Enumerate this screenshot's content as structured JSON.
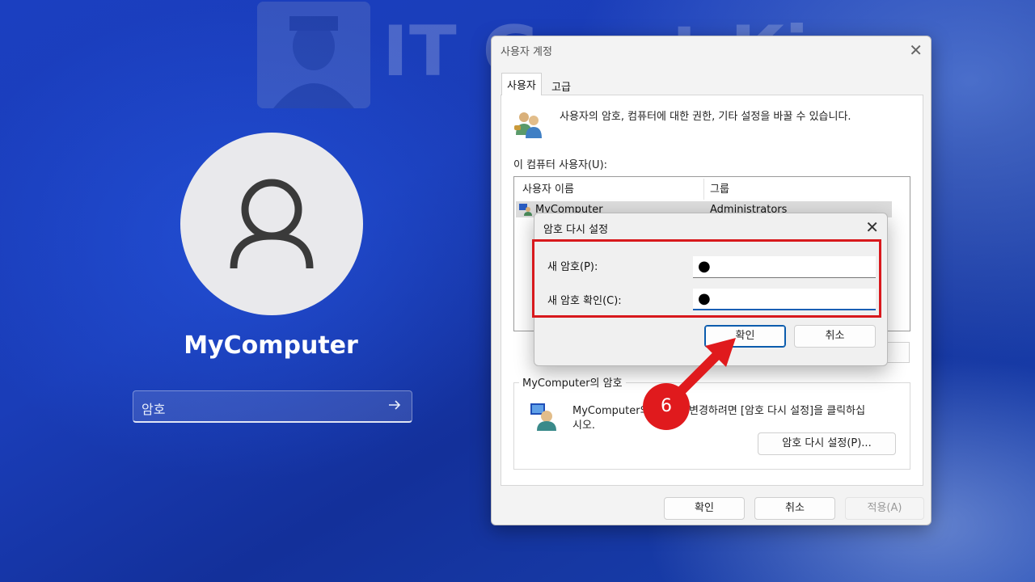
{
  "watermark": {
    "text": "IT Great King"
  },
  "lock_screen": {
    "user_name": "MyComputer",
    "password_placeholder": "암호"
  },
  "user_accounts": {
    "title": "사용자 계정",
    "tabs": [
      {
        "label": "사용자"
      },
      {
        "label": "고급"
      }
    ],
    "description": "사용자의 암호, 컴퓨터에 대한 권한, 기타 설정을 바꿀 수 있습니다.",
    "users_label": "이 컴퓨터 사용자(U):",
    "columns": [
      "사용자 이름",
      "그룹"
    ],
    "rows": [
      {
        "name": "MyComputer",
        "group": "Administrators"
      }
    ],
    "group_title": "MyComputer의 암호",
    "group_text_a": "MyComputer의",
    "group_text_b": "변경하려면 [암호 다시 설정]을 클릭하십",
    "group_text_c": "시오.",
    "reset_button": "암호 다시 설정(P)...",
    "ok_button": "확인",
    "cancel_button": "취소",
    "apply_button": "적용(A)"
  },
  "reset_dialog": {
    "title": "암호 다시 설정",
    "new_password_label": "새 암호(P):",
    "new_password_value": "●",
    "confirm_label": "새 암호 확인(C):",
    "confirm_value": "●",
    "ok_button": "확인",
    "cancel_button": "취소"
  },
  "annotation": {
    "step_number": "6",
    "highlight_color": "#d8191d"
  }
}
